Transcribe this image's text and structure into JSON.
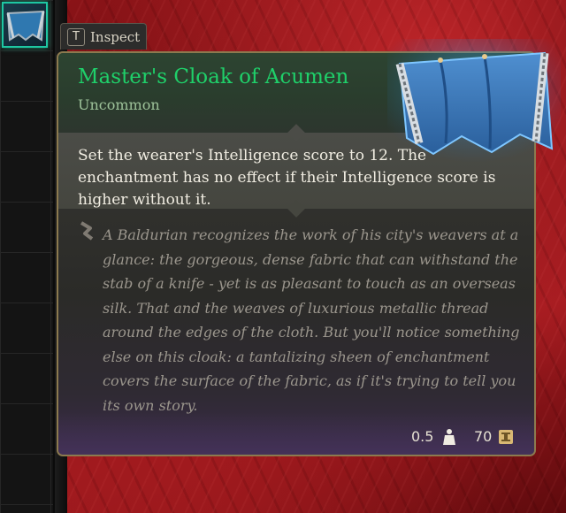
{
  "item": {
    "name": "Master's Cloak of Acumen",
    "rarity": "Uncommon",
    "description": "Set the wearer's Intelligence score to 12. The enchantment has no effect if their Intelligence score is higher without it.",
    "lore": "A Baldurian recognizes the work of his city's weavers at a glance: the gorgeous, dense fabric that can withstand the stab of a knife - yet is as pleasant to touch as an overseas silk. That and the weaves of luxurious metallic thread around the edges of the cloth. But you'll notice something else on this cloak: a tantalizing sheen of enchantment covers the surface of the fabric, as if it's trying to tell you its own story.",
    "weight": "0.5",
    "weight_icon": "weight-icon",
    "price": "70",
    "price_icon": "gold-coin-icon",
    "image": "cloak-icon"
  },
  "inspect": {
    "key": "T",
    "label": "Inspect"
  },
  "colors": {
    "rarity_accent": "#1fd06a",
    "panel_border": "#8c7a4f",
    "slot_highlight": "#1ec7a2"
  }
}
